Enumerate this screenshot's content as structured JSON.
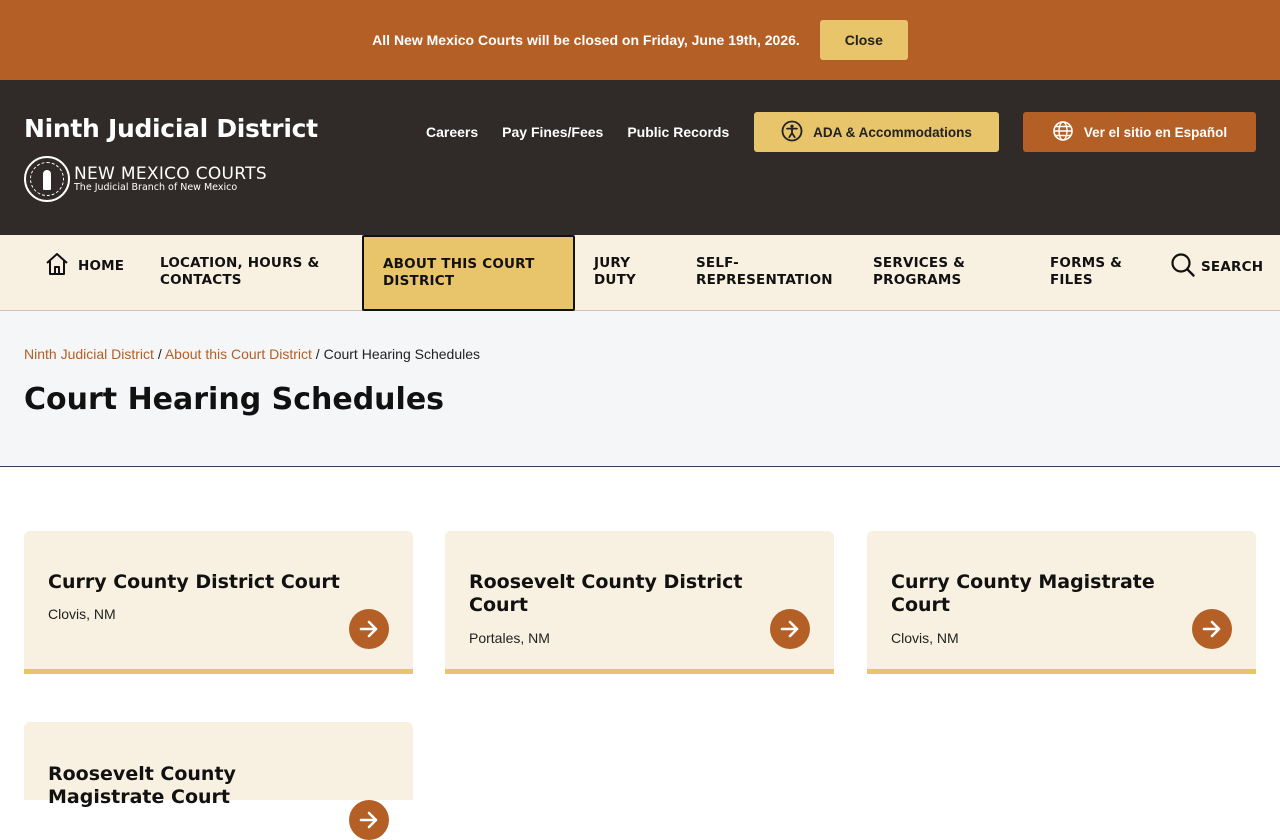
{
  "alert": {
    "message": "All New Mexico Courts will be closed on Friday, June 19th, 2026.",
    "close_label": "Close"
  },
  "header": {
    "site_title": "Ninth Judicial District",
    "logo_name": "NEW MEXICO COURTS",
    "logo_subtitle": "The Judicial Branch of New Mexico",
    "util_links": [
      "Careers",
      "Pay Fines/Fees",
      "Public Records"
    ],
    "ada_label": "ADA & Accommodations",
    "spanish_label": "Ver el sitio en Español"
  },
  "nav": {
    "home": "HOME",
    "items": [
      {
        "line1": "LOCATION, HOURS &",
        "line2": "CONTACTS"
      },
      {
        "line1": "ABOUT THIS COURT",
        "line2": "DISTRICT"
      },
      {
        "line1": "JURY",
        "line2": "DUTY"
      },
      {
        "line1": "SELF-",
        "line2": "REPRESENTATION"
      },
      {
        "line1": "SERVICES &",
        "line2": "PROGRAMS"
      },
      {
        "line1": "FORMS &",
        "line2": "FILES"
      }
    ],
    "search": "SEARCH",
    "active": "ABOUT THIS COURT DISTRICT"
  },
  "breadcrumb": {
    "home": "Ninth Judicial District",
    "parent": "About this Court District",
    "current": "Court Hearing Schedules",
    "separator": "/"
  },
  "page_title": "Court Hearing Schedules",
  "cards": [
    {
      "title": "Curry County District Court",
      "location": "Clovis, NM"
    },
    {
      "title": "Roosevelt County District Court",
      "location": "Portales, NM"
    },
    {
      "title": "Curry County Magistrate Court",
      "location": "Clovis, NM"
    },
    {
      "title": "Roosevelt County Magistrate Court",
      "location": ""
    }
  ],
  "colors": {
    "accent_orange": "#b45f26",
    "accent_gold": "#e8c46a",
    "header_dark": "#302b28",
    "cream": "#f8f0e0"
  }
}
